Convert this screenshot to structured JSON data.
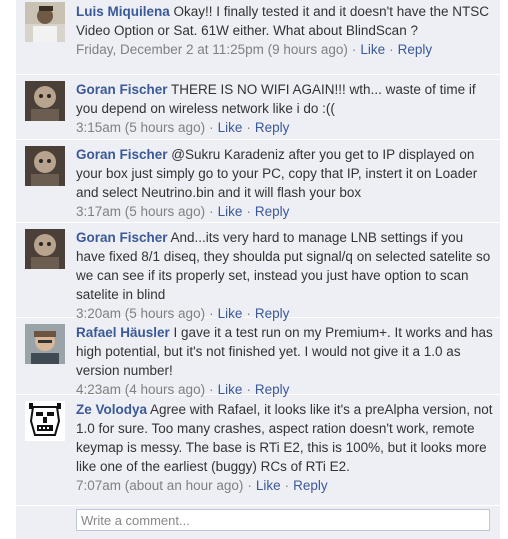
{
  "comments": [
    {
      "author": "Luis Miquilena",
      "text": " Okay!! I finally tested it and it doesn't have the NTSC Video Option or Sat. 61W either. What about BlindScan ?",
      "time": "Friday, December 2 at 11:25pm (9 hours ago)",
      "like": "Like",
      "reply": "Reply"
    },
    {
      "author": "Goran Fischer",
      "text": " THERE IS NO WIFI AGAIN!!! wth... waste of time if you depend on wireless network like i do :((",
      "time": "3:15am (5 hours ago)",
      "like": "Like",
      "reply": "Reply"
    },
    {
      "author": "Goran Fischer",
      "text": " @Sukru Karadeniz after you get to IP displayed on your box just simply go to your PC, copy that IP, instert it on Loader and select Neutrino.bin and it will flash your box",
      "time": "3:17am (5 hours ago)",
      "like": "Like",
      "reply": "Reply"
    },
    {
      "author": "Goran Fischer",
      "text": " And...its very hard to manage LNB settings if you have fixed 8/1 diseq, they shoulda put signal/q on selected satelite so we can see if its properly set, instead you just have option to scan satelite in blind",
      "time": "3:20am (5 hours ago)",
      "like": "Like",
      "reply": "Reply"
    },
    {
      "author": "Rafael Häusler",
      "text": " I gave it a test run on my Premium+. It works and has high potential, but it's not finished yet. I would not give it a 1.0 as version number!",
      "time": "4:23am (4 hours ago)",
      "like": "Like",
      "reply": "Reply"
    },
    {
      "author": "Ze Volodya",
      "text": " Agree with Rafael, it looks like it's a preAlpha version, not 1.0 for sure. Too many crashes, aspect ration doesn't work, remote keymap is messy. The base is RTi E2, this is 100%, but it looks more like one of the earliest (buggy) RCs of RTi E2.",
      "time": "7:07am (about an hour ago)",
      "like": "Like",
      "reply": "Reply"
    }
  ],
  "write_comment": {
    "placeholder": "Write a comment..."
  },
  "separator": "·"
}
